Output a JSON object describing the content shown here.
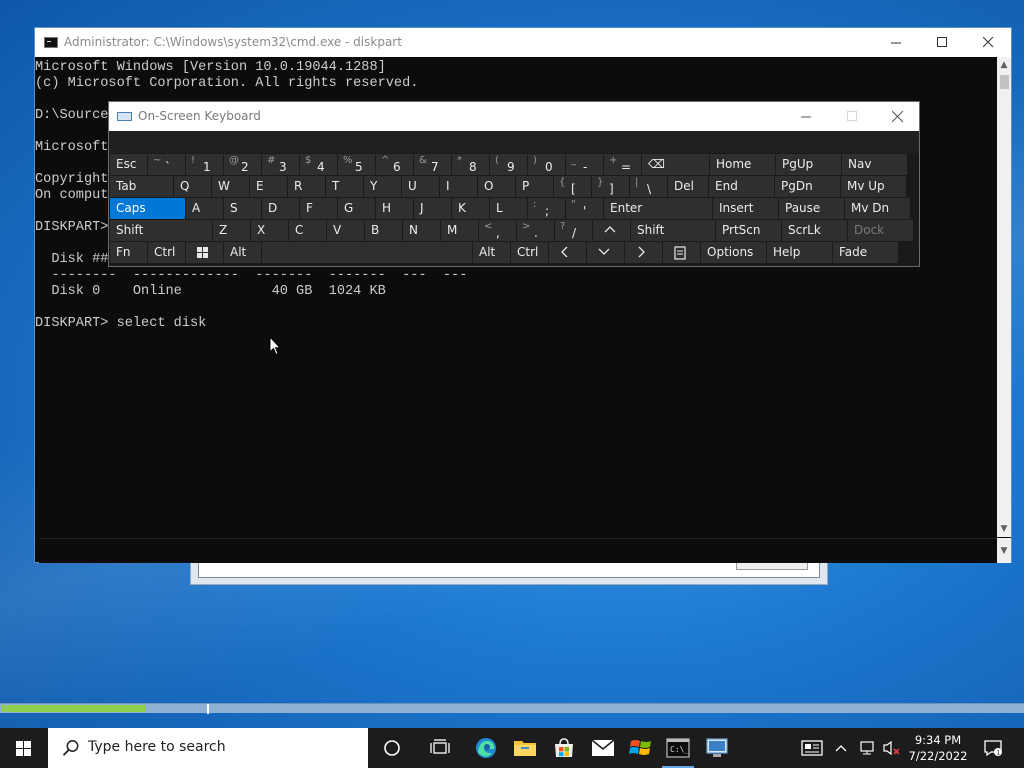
{
  "cmd": {
    "title": "Administrator: C:\\Windows\\system32\\cmd.exe - diskpart",
    "lines": [
      "Microsoft Windows [Version 10.0.19044.1288]",
      "(c) Microsoft Corporation. All rights reserved.",
      "",
      "D:\\Source",
      "",
      "Microsoft",
      "",
      "Copyright",
      "On comput",
      "",
      "DISKPART>",
      "",
      "  Disk ###",
      "  --------  -------------  -------  -------  ---  ---",
      "  Disk 0    Online           40 GB  1024 KB",
      "",
      "DISKPART> select disk"
    ]
  },
  "osk": {
    "title": "On-Screen Keyboard",
    "rows": [
      [
        {
          "label": "Esc"
        },
        {
          "shift": "~",
          "main": "`"
        },
        {
          "shift": "!",
          "main": "1"
        },
        {
          "shift": "@",
          "main": "2"
        },
        {
          "shift": "#",
          "main": "3"
        },
        {
          "shift": "$",
          "main": "4"
        },
        {
          "shift": "%",
          "main": "5"
        },
        {
          "shift": "^",
          "main": "6"
        },
        {
          "shift": "&",
          "main": "7"
        },
        {
          "shift": "*",
          "main": "8"
        },
        {
          "shift": "(",
          "main": "9"
        },
        {
          "shift": ")",
          "main": "0"
        },
        {
          "shift": "_",
          "main": "-"
        },
        {
          "shift": "+",
          "main": "="
        },
        {
          "label": "⌫"
        },
        {
          "label": "Home"
        },
        {
          "label": "PgUp"
        },
        {
          "label": "Nav"
        }
      ],
      [
        {
          "label": "Tab"
        },
        {
          "label": "Q"
        },
        {
          "label": "W"
        },
        {
          "label": "E"
        },
        {
          "label": "R"
        },
        {
          "label": "T"
        },
        {
          "label": "Y"
        },
        {
          "label": "U"
        },
        {
          "label": "I"
        },
        {
          "label": "O"
        },
        {
          "label": "P"
        },
        {
          "shift": "{",
          "main": "["
        },
        {
          "shift": "}",
          "main": "]"
        },
        {
          "shift": "|",
          "main": "\\"
        },
        {
          "label": "Del"
        },
        {
          "label": "End"
        },
        {
          "label": "PgDn"
        },
        {
          "label": "Mv Up"
        }
      ],
      [
        {
          "label": "Caps"
        },
        {
          "label": "A"
        },
        {
          "label": "S"
        },
        {
          "label": "D"
        },
        {
          "label": "F"
        },
        {
          "label": "G"
        },
        {
          "label": "H"
        },
        {
          "label": "J"
        },
        {
          "label": "K"
        },
        {
          "label": "L"
        },
        {
          "shift": ":",
          "main": ";"
        },
        {
          "shift": "\"",
          "main": "'"
        },
        {
          "label": "Enter"
        },
        {
          "label": "Insert"
        },
        {
          "label": "Pause"
        },
        {
          "label": "Mv Dn"
        }
      ],
      [
        {
          "label": "Shift"
        },
        {
          "label": "Z"
        },
        {
          "label": "X"
        },
        {
          "label": "C"
        },
        {
          "label": "V"
        },
        {
          "label": "B"
        },
        {
          "label": "N"
        },
        {
          "label": "M"
        },
        {
          "shift": "<",
          "main": ","
        },
        {
          "shift": ">",
          "main": "."
        },
        {
          "shift": "?",
          "main": "/"
        },
        {
          "label": "^"
        },
        {
          "label": "Shift"
        },
        {
          "label": "PrtScn"
        },
        {
          "label": "ScrLk"
        },
        {
          "label": "Dock"
        }
      ],
      [
        {
          "label": "Fn"
        },
        {
          "label": "Ctrl"
        },
        {
          "label": "win-icon"
        },
        {
          "label": "Alt"
        },
        {
          "label": ""
        },
        {
          "label": "Alt"
        },
        {
          "label": "Ctrl"
        },
        {
          "label": "<"
        },
        {
          "label": "v"
        },
        {
          "label": ">"
        },
        {
          "label": "menu-icon"
        },
        {
          "label": "Options"
        },
        {
          "label": "Help"
        },
        {
          "label": "Fade"
        }
      ]
    ]
  },
  "taskbar": {
    "search_placeholder": "Type here to search",
    "clock_time": "9:34 PM",
    "clock_date": "7/22/2022",
    "pinned": [
      "task-view-icon",
      "edge-icon",
      "file-explorer-icon",
      "store-icon",
      "mail-icon",
      "windows-flag-icon",
      "cmd-icon",
      "remote-desktop-icon"
    ]
  },
  "progress": {
    "fill_fraction": 0.14
  }
}
